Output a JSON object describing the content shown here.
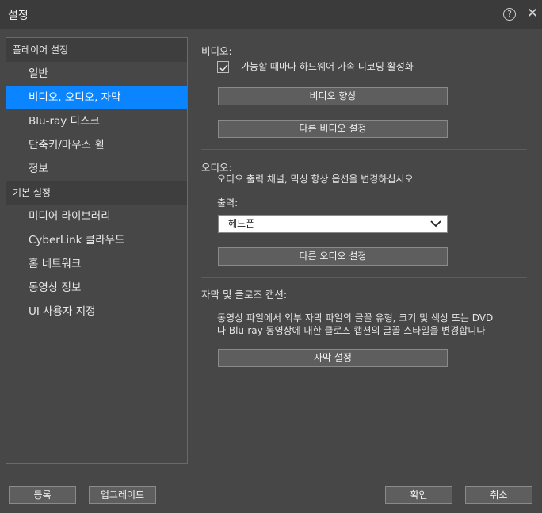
{
  "window": {
    "title": "설정",
    "help_glyph": "?",
    "close_glyph": "✕"
  },
  "sidebar": {
    "groups": [
      {
        "header": "플레이어 설정",
        "items": [
          "일반",
          "비디오, 오디오, 자막",
          "Blu-ray 디스크",
          "단축키/마우스 휠",
          "정보"
        ]
      },
      {
        "header": "기본 설정",
        "items": [
          "미디어 라이브러리",
          "CyberLink 클라우드",
          "홈 네트워크",
          "동영상 정보",
          "UI 사용자 지정"
        ]
      }
    ],
    "active_item": "비디오, 오디오, 자막"
  },
  "video": {
    "label": "비디오:",
    "hw_decode_label": "가능할 때마다 하드웨어 가속 디코딩 활성화",
    "hw_decode_checked": true,
    "enhance_button": "비디오 향상",
    "other_button": "다른 비디오 설정"
  },
  "audio": {
    "label": "오디오:",
    "description": "오디오 출력 채널, 믹싱 향상 옵션을 변경하십시오",
    "output_label": "출력:",
    "output_value": "헤드폰",
    "other_button": "다른 오디오 설정"
  },
  "subtitles": {
    "label": "자막 및 클로즈 캡션:",
    "description_line1": "동영상 파일에서 외부 자막 파일의 글꼴 유형, 크기 및 색상 또는 DVD",
    "description_line2": "나 Blu-ray 동영상에 대한 클로즈 캡션의 글꼴 스타일을 변경합니다",
    "settings_button": "자막 설정"
  },
  "footer": {
    "register": "등록",
    "upgrade": "업그레이드",
    "ok": "확인",
    "cancel": "취소"
  }
}
